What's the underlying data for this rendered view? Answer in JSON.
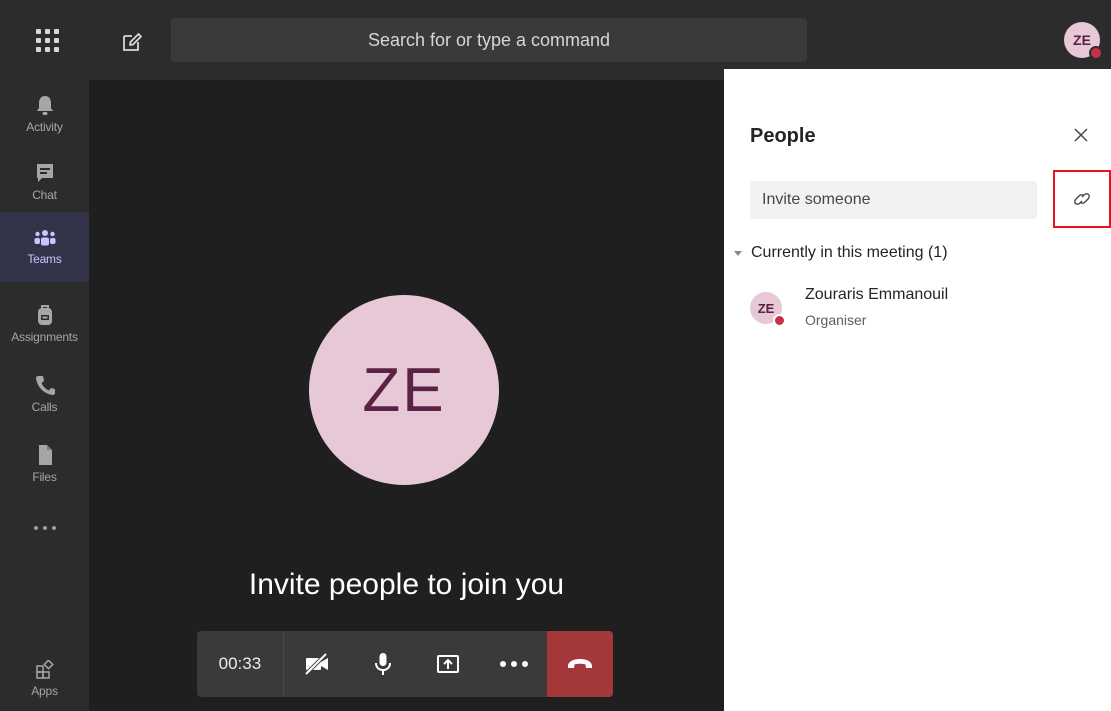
{
  "topbar": {
    "search_placeholder": "Search for or type a command",
    "user_initials": "ZE"
  },
  "rail": {
    "items": [
      {
        "label": "Activity",
        "icon": "bell-icon"
      },
      {
        "label": "Chat",
        "icon": "chat-icon"
      },
      {
        "label": "Teams",
        "icon": "teams-icon",
        "active": true
      },
      {
        "label": "Assignments",
        "icon": "backpack-icon"
      },
      {
        "label": "Calls",
        "icon": "phone-icon"
      },
      {
        "label": "Files",
        "icon": "file-icon"
      }
    ],
    "apps_label": "Apps"
  },
  "stage": {
    "avatar_initials": "ZE",
    "message": "Invite people to join you"
  },
  "controls": {
    "timer": "00:33"
  },
  "people_panel": {
    "title": "People",
    "invite_placeholder": "Invite someone",
    "section_label": "Currently in this meeting (1)",
    "participants": [
      {
        "initials": "ZE",
        "name": "Zouraris Emmanouil",
        "role": "Organiser"
      }
    ]
  },
  "colors": {
    "accent": "#5b5fc7",
    "avatar_bg": "#e7c8d7",
    "avatar_text": "#5b2245",
    "status_busy": "#c4314b",
    "hangup": "#a4373a",
    "highlight_box": "#e81123"
  }
}
